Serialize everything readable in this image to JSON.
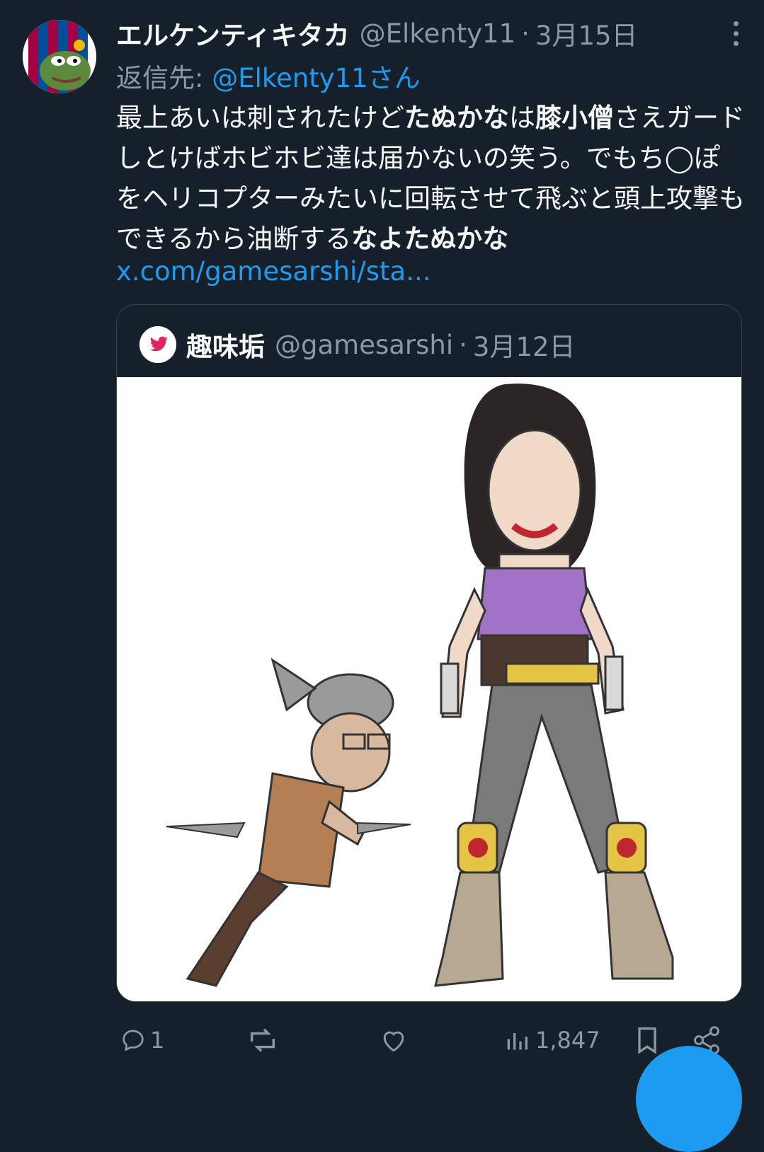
{
  "tweet": {
    "display_name": "エルケンティキタカ",
    "handle": "@Elkenty11",
    "separator": "·",
    "date": "3月15日",
    "reply_prefix": "返信先:",
    "reply_target": "@Elkenty11さん",
    "body_segments": [
      {
        "text": "最上あいは刺されたけど",
        "bold": false
      },
      {
        "text": "たぬかな",
        "bold": true
      },
      {
        "text": "は",
        "bold": false
      },
      {
        "text": "膝小僧",
        "bold": true
      },
      {
        "text": "さえガードしとけばホビホビ達は届かないの笑う。でもち◯ぽをヘリコプターみたいに回転させて飛ぶと頭上攻撃もできるから油断する",
        "bold": false
      },
      {
        "text": "なよたぬかな",
        "bold": true
      }
    ],
    "link": "x.com/gamesarshi/sta..."
  },
  "quoted_tweet": {
    "display_name": "趣味垢",
    "handle": "@gamesarshi",
    "separator": "·",
    "date": "3月12日",
    "image_description": "illustration"
  },
  "actions": {
    "reply_count": "1",
    "retweet_count": "",
    "like_count": "",
    "views_count": "1,847"
  },
  "icons": [
    "more-icon",
    "reply-icon",
    "retweet-icon",
    "like-icon",
    "views-icon",
    "bookmark-icon",
    "share-icon",
    "compose-fab"
  ],
  "colors": {
    "background": "#15202b",
    "accent": "#1d9bf0",
    "muted": "#8b98a5",
    "text": "#f7f9f9"
  }
}
